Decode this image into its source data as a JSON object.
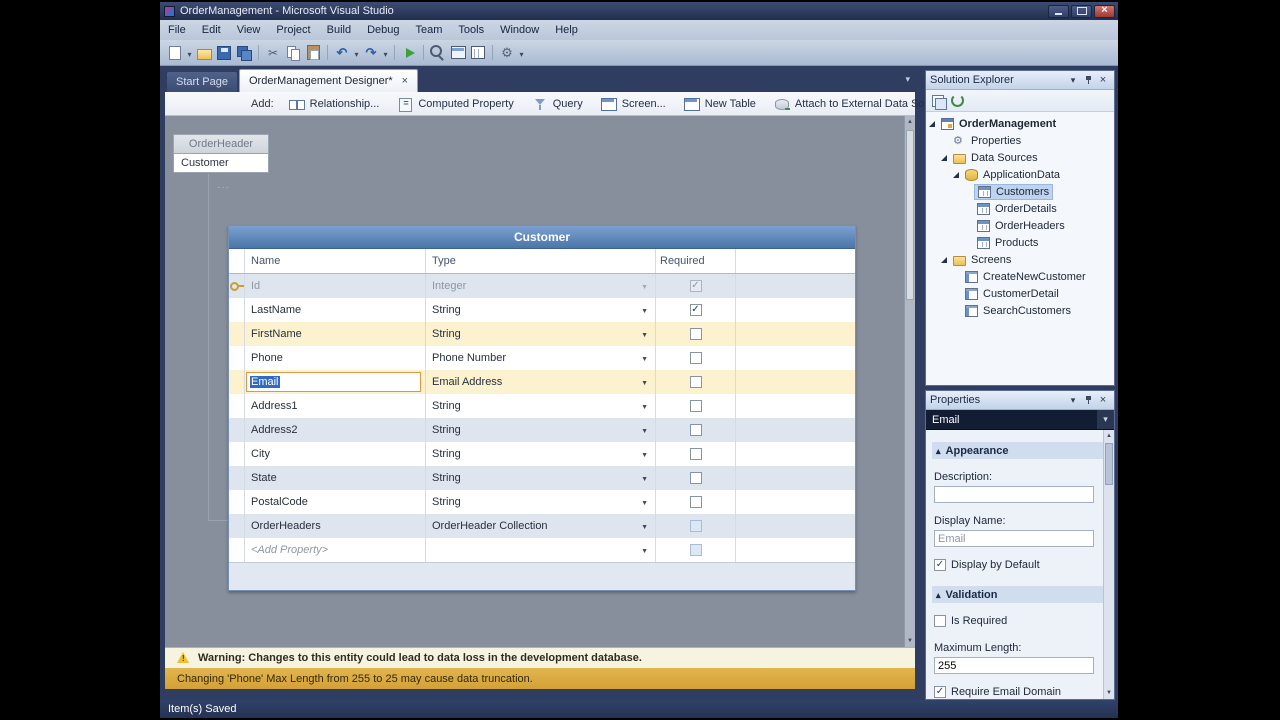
{
  "window": {
    "title": "OrderManagement - Microsoft Visual Studio"
  },
  "menu": {
    "items": [
      "File",
      "Edit",
      "View",
      "Project",
      "Build",
      "Debug",
      "Team",
      "Tools",
      "Window",
      "Help"
    ]
  },
  "toolbar": {
    "icons": [
      "new-item",
      "caret",
      "open-file",
      "save",
      "save-all",
      "sep",
      "cut",
      "copy",
      "paste",
      "sep",
      "undo",
      "caret",
      "redo",
      "caret",
      "sep",
      "start-debugging",
      "sep",
      "find",
      "web-browser",
      "solution-explorer",
      "sep",
      "properties-window",
      "caret"
    ]
  },
  "tabs": [
    {
      "label": "Start Page",
      "active": false
    },
    {
      "label": "OrderManagement Designer*",
      "active": true
    }
  ],
  "designer": {
    "add_label": "Add:",
    "add_buttons": [
      {
        "label": "Relationship...",
        "icon": "relationship"
      },
      {
        "label": "Computed Property",
        "icon": "computed-property"
      },
      {
        "label": "Query",
        "icon": "query"
      },
      {
        "label": "Screen...",
        "icon": "screen"
      },
      {
        "label": "New Table",
        "icon": "new-table"
      },
      {
        "label": "Attach to External Data Source...",
        "icon": "attach-data-source"
      }
    ],
    "entity": {
      "related": "OrderHeader",
      "name": "Customer"
    },
    "table": {
      "title": "Customer",
      "columns": [
        "Name",
        "Type",
        "Required"
      ],
      "rows": [
        {
          "name": "Id",
          "type": "Integer",
          "required": true,
          "disabled": true,
          "key": true
        },
        {
          "name": "LastName",
          "type": "String",
          "required": true
        },
        {
          "name": "FirstName",
          "type": "String",
          "required": false,
          "highlight": true
        },
        {
          "name": "Phone",
          "type": "Phone Number",
          "required": false
        },
        {
          "name": "Email",
          "type": "Email Address",
          "required": false,
          "highlight": true,
          "editing": true
        },
        {
          "name": "Address1",
          "type": "String",
          "required": false
        },
        {
          "name": "Address2",
          "type": "String",
          "required": false
        },
        {
          "name": "City",
          "type": "String",
          "required": false
        },
        {
          "name": "State",
          "type": "String",
          "required": false
        },
        {
          "name": "PostalCode",
          "type": "String",
          "required": false
        },
        {
          "name": "OrderHeaders",
          "type": "OrderHeader Collection",
          "required": false,
          "check_soft": true
        },
        {
          "name": "<Add Property>",
          "type": "",
          "required": false,
          "placeholder": true,
          "check_soft": true
        }
      ]
    },
    "warnings": [
      {
        "level": "warning",
        "icon": true,
        "text": "Warning: Changes to this entity could lead to data loss in the development database."
      },
      {
        "level": "detail",
        "icon": false,
        "text": "Changing 'Phone' Max Length from 255 to 25 may cause data truncation."
      }
    ]
  },
  "solution_explorer": {
    "title": "Solution Explorer",
    "tree": [
      {
        "label": "OrderManagement",
        "level": 0,
        "expanded": true,
        "bold": true,
        "icon": "app"
      },
      {
        "label": "Properties",
        "level": 1,
        "icon": "properties"
      },
      {
        "label": "Data Sources",
        "level": 1,
        "expanded": true,
        "icon": "folder"
      },
      {
        "label": "ApplicationData",
        "level": 2,
        "expanded": true,
        "icon": "db"
      },
      {
        "label": "Customers",
        "level": 3,
        "icon": "table",
        "selected": true
      },
      {
        "label": "OrderDetails",
        "level": 3,
        "icon": "table"
      },
      {
        "label": "OrderHeaders",
        "level": 3,
        "icon": "table"
      },
      {
        "label": "Products",
        "level": 3,
        "icon": "table"
      },
      {
        "label": "Screens",
        "level": 1,
        "expanded": true,
        "icon": "folder"
      },
      {
        "label": "CreateNewCustomer",
        "level": 2,
        "icon": "screen"
      },
      {
        "label": "CustomerDetail",
        "level": 2,
        "icon": "screen"
      },
      {
        "label": "SearchCustomers",
        "level": 2,
        "icon": "screen"
      }
    ]
  },
  "properties_panel": {
    "title": "Properties",
    "object_selector": "Email",
    "appearance": {
      "title": "Appearance",
      "description_label": "Description:",
      "description_value": "",
      "display_name_label": "Display Name:",
      "display_name_value": "Email",
      "display_by_default": {
        "label": "Display by Default",
        "checked": true
      }
    },
    "validation": {
      "title": "Validation",
      "is_required": {
        "label": "Is Required",
        "checked": false
      },
      "max_length_label": "Maximum Length:",
      "max_length_value": "255",
      "require_email_domain": {
        "label": "Require Email Domain",
        "checked": true
      }
    }
  },
  "status_bar": {
    "text": "Item(s) Saved"
  },
  "colors": {
    "accent_selection": "#316ac5",
    "row_highlight": "#fcf2cf",
    "table_header_blue": "#5b87bb",
    "warning_gold": "#d8a93c",
    "status_bar_blue": "#2d3e63",
    "explorer_selection": "#bdd3f0"
  }
}
